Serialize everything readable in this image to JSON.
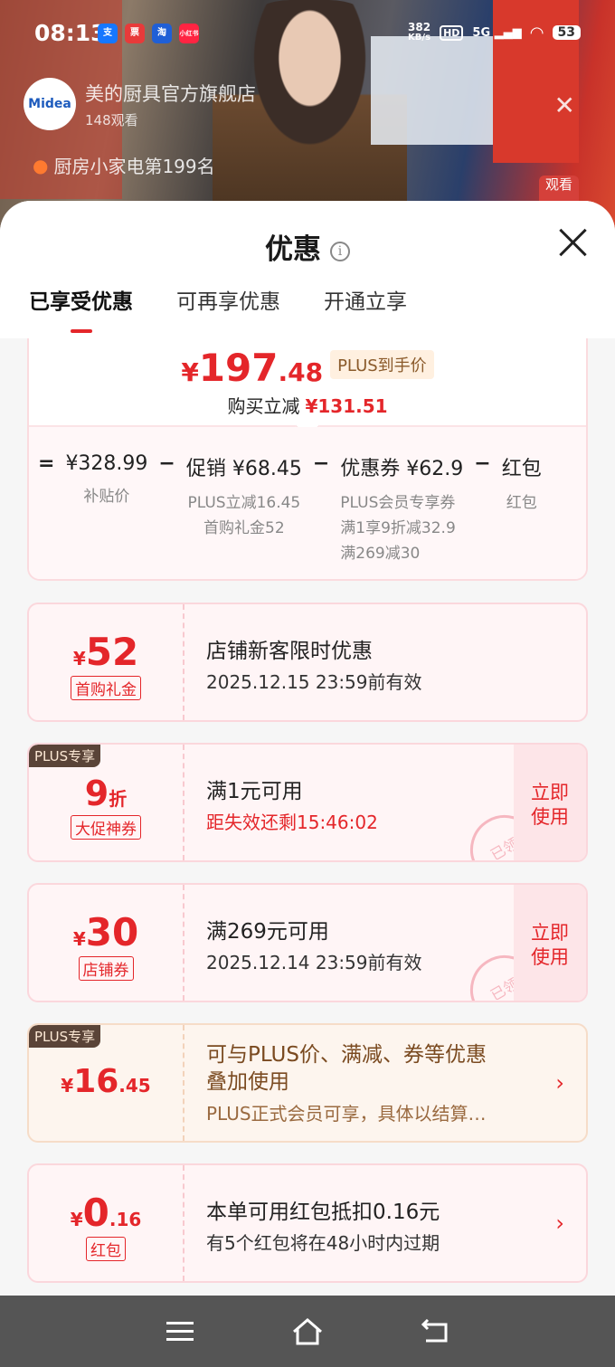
{
  "status_bar": {
    "time": "08:13",
    "net_speed_value": "382",
    "net_speed_unit": "KB/s",
    "hd": "HD",
    "signal": "5G",
    "battery": "53",
    "app_badges": [
      "支",
      "票",
      "淘",
      "小红书"
    ]
  },
  "background": {
    "store_logo": "Midea",
    "store_name": "美的厨具官方旗舰店",
    "viewers": "148观看",
    "rank": "厨房小家电第199名",
    "watch_btn": "观看"
  },
  "sheet": {
    "title": "优惠",
    "info_icon": "i",
    "tabs": [
      "已享受优惠",
      "可再享优惠",
      "开通立享"
    ]
  },
  "summary": {
    "price_currency": "¥",
    "price_int": "197",
    "price_dec": ".48",
    "plus_tag": "PLUS到手价",
    "reduce_label": "购买立减",
    "reduce_amount": "¥131.51",
    "calc": {
      "eq": "=",
      "minus": "−",
      "items": [
        {
          "value": "¥328.99",
          "subs": [
            "补贴价"
          ]
        },
        {
          "value": "促销 ¥68.45",
          "subs": [
            "PLUS立减16.45",
            "首购礼金52"
          ]
        },
        {
          "value": "优惠券 ¥62.9",
          "subs": [
            "PLUS会员专享券",
            "满1享9折减32.9",
            "满269减30"
          ]
        },
        {
          "value": "红包",
          "subs": [
            "红包"
          ]
        }
      ]
    }
  },
  "coupons": [
    {
      "currency": "¥",
      "amount": "52",
      "label": "首购礼金",
      "title": "店铺新客限时优惠",
      "sub": "2025.12.15 23:59前有效"
    },
    {
      "plus_badge": "PLUS专享",
      "amount": "9",
      "unit": "折",
      "label": "大促神券",
      "title": "满1元可用",
      "sub": "距失效还剩15:46:02",
      "use": "立即\n使用",
      "stamp": "已领"
    },
    {
      "currency": "¥",
      "amount": "30",
      "label": "店铺券",
      "title": "满269元可用",
      "sub": "2025.12.14 23:59前有效",
      "use": "立即\n使用",
      "stamp": "已领"
    },
    {
      "plus_badge": "PLUS专享",
      "currency": "¥",
      "amount": "16",
      "dec": ".45",
      "title": "可与PLUS价、满减、券等优惠叠加使用",
      "sub": "PLUS正式会员可享，具体以结算…"
    },
    {
      "currency": "¥",
      "amount": "0",
      "dec": ".16",
      "label": "红包",
      "title": "本单可用红包抵扣0.16元",
      "sub": "有5个红包将在48小时内过期"
    }
  ],
  "colors": {
    "accent": "#e4262a",
    "plus_dark": "#5a4438",
    "gold_text": "#7a4a20"
  }
}
